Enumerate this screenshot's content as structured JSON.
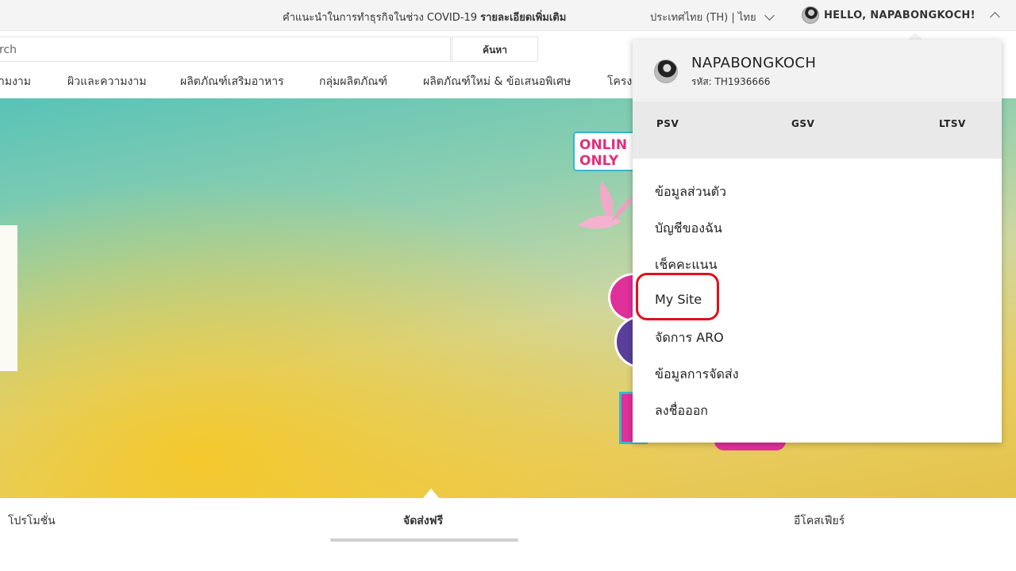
{
  "topbar": {
    "covid_text": "คำแนะนำในการทำธุรกิจในช่วง COVID-19",
    "covid_link": "รายละเอียดเพิ่มเติม",
    "country": "ประเทศไทย (TH) | ไทย",
    "hello": "HELLO, NAPABONGKOCH!"
  },
  "search": {
    "placeholder": "rch",
    "button": "ค้นหา"
  },
  "nav": {
    "items": [
      "ามงาม",
      "ผิวและความงาม",
      "ผลิตภัณฑ์เสริมอาหาร",
      "กลุ่มผลิตภัณฑ์",
      "ผลิตภัณฑ์ใหม่ & ข้อเสนอพิเศษ",
      "โครง"
    ]
  },
  "hero": {
    "badge": "ONLIN\nONLY"
  },
  "tabs": {
    "items": [
      "โปรโมชั่น",
      "จัดส่งฟรี",
      "อีโคสเฟียร์"
    ],
    "active": "จัดส่งฟรี"
  },
  "user_menu": {
    "name": "NAPABONGKOCH",
    "code": "รหัส: TH1936666",
    "stats": [
      "PSV",
      "GSV",
      "LTSV"
    ],
    "items": [
      "ข้อมูลส่วนตัว",
      "บัญชีของฉัน",
      "เช็คคะแนน",
      "My Site",
      "จัดการ ARO",
      "ข้อมูลการจัดส่ง",
      "ลงชื่อออก"
    ],
    "highlighted": "My Site",
    "highlight_color": "#e0101a"
  }
}
